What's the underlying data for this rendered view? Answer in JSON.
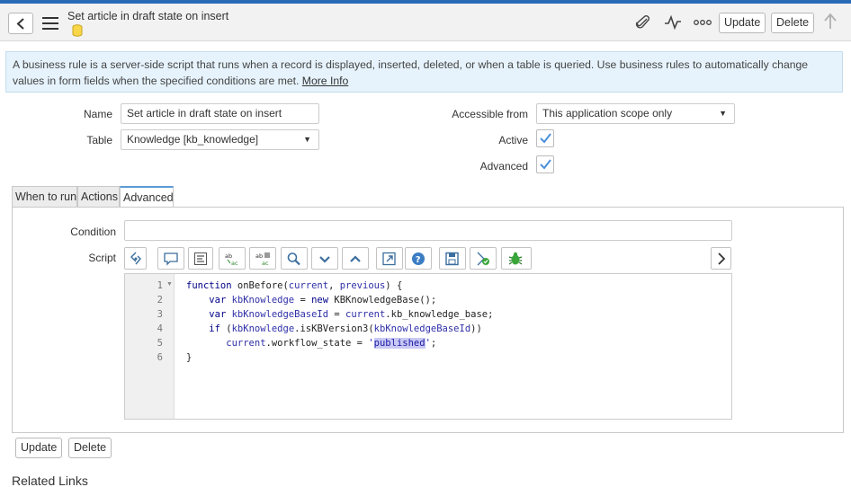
{
  "header": {
    "title": "Set article in draft state on insert",
    "update_label": "Update",
    "delete_label": "Delete"
  },
  "info": {
    "text": "A business rule is a server-side script that runs when a record is displayed, inserted, deleted, or when a table is queried. Use business rules to automatically change values in form fields when the specified conditions are met.",
    "link": "More Info"
  },
  "form": {
    "name_label": "Name",
    "name_value": "Set article in draft state on insert",
    "table_label": "Table",
    "table_value": "Knowledge [kb_knowledge]",
    "accessible_label": "Accessible from",
    "accessible_value": "This application scope only",
    "active_label": "Active",
    "active_checked": true,
    "advanced_label": "Advanced",
    "advanced_checked": true
  },
  "tabs": [
    "When to run",
    "Actions",
    "Advanced"
  ],
  "active_tab": "Advanced",
  "advanced": {
    "condition_label": "Condition",
    "condition_value": "",
    "script_label": "Script"
  },
  "toolbar_icons": [
    "script-include-icon",
    "comment-icon",
    "format-icon",
    "replace-icon",
    "replace-all-icon",
    "search-icon",
    "collapse-icon",
    "expand-icon",
    "fullscreen-icon",
    "help-icon",
    "save-icon",
    "syntax-check-icon",
    "debug-icon",
    "next-icon"
  ],
  "script": {
    "line_numbers": [
      "1",
      "2",
      "3",
      "4",
      "5",
      "6"
    ],
    "lines": [
      "function onBefore(current, previous) {",
      "    var kbKnowledge = new KBKnowledgeBase();",
      "    var kbKnowledgeBaseId = current.kb_knowledge_base;",
      "    if (kbKnowledge.isKBVersion3(kbKnowledgeBaseId))",
      "       current.workflow_state = 'published';",
      "}"
    ]
  },
  "footer": {
    "update_label": "Update",
    "delete_label": "Delete",
    "related_links": "Related Links"
  },
  "colors": {
    "accent": "#2a6ab5",
    "info_bg": "#e6f3fc",
    "check": "#4a90d9"
  }
}
